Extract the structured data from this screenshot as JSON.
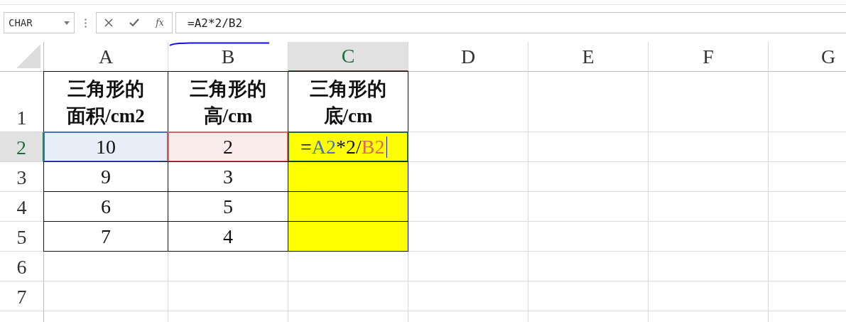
{
  "name_box": {
    "value": "CHAR"
  },
  "formula_bar": {
    "fx_label": "fx",
    "value": "=A2*2/B2"
  },
  "columns": [
    {
      "label": "A",
      "selected": false
    },
    {
      "label": "B",
      "selected": false
    },
    {
      "label": "C",
      "selected": true
    },
    {
      "label": "D",
      "selected": false
    },
    {
      "label": "E",
      "selected": false
    },
    {
      "label": "F",
      "selected": false
    },
    {
      "label": "G",
      "selected": false
    }
  ],
  "rows": [
    {
      "label": "1",
      "selected": false,
      "cells": [
        {
          "text": "三角形的面积/cm2",
          "highlighted": false
        },
        {
          "text": "三角形的高/cm",
          "highlighted": false
        },
        {
          "text": "三角形的底/cm",
          "highlighted": false
        }
      ]
    },
    {
      "label": "2",
      "selected": true,
      "cells": [
        {
          "text": "10",
          "highlighted": false,
          "color": "#4472c4"
        },
        {
          "text": "2",
          "highlighted": false,
          "color": "#e06666"
        },
        {
          "kind": "editing",
          "highlighted": true,
          "active": true,
          "parts": [
            {
              "text": "="
            },
            {
              "text": "A2",
              "color": "#4472c4"
            },
            {
              "text": "*2/"
            },
            {
              "text": "B2",
              "color": "#e06666"
            }
          ]
        }
      ]
    },
    {
      "label": "3",
      "selected": false,
      "cells": [
        {
          "text": "9",
          "highlighted": false
        },
        {
          "text": "3",
          "highlighted": false
        },
        {
          "text": "",
          "highlighted": true
        }
      ]
    },
    {
      "label": "4",
      "selected": false,
      "cells": [
        {
          "text": "6",
          "highlighted": false
        },
        {
          "text": "5",
          "highlighted": false
        },
        {
          "text": "",
          "highlighted": true
        }
      ]
    },
    {
      "label": "5",
      "selected": false,
      "cells": [
        {
          "text": "7",
          "highlighted": false
        },
        {
          "text": "4",
          "highlighted": false
        },
        {
          "text": "",
          "highlighted": true
        }
      ]
    },
    {
      "label": "6",
      "selected": false,
      "cells": []
    },
    {
      "label": "7",
      "selected": false,
      "cells": []
    }
  ]
}
